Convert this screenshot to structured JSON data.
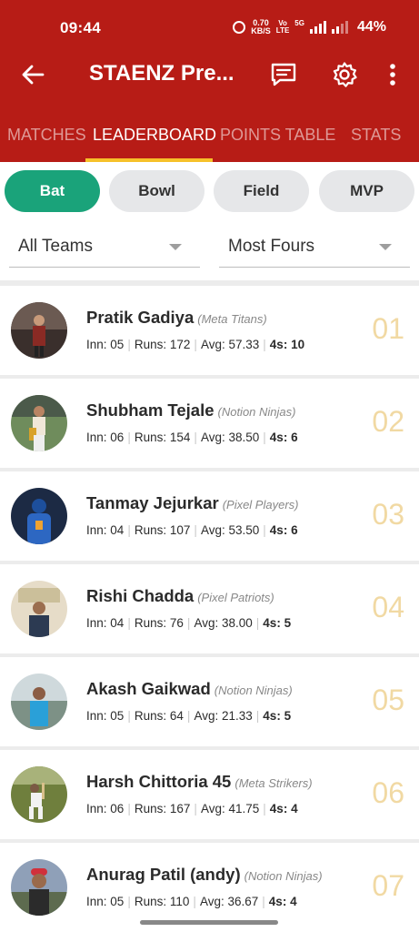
{
  "status_bar": {
    "time": "09:44",
    "speed_top": "0.70",
    "speed_bottom": "KB/S",
    "volte_top": "Vo",
    "volte_bottom": "LTE",
    "network": "5G",
    "battery": "44%"
  },
  "toolbar": {
    "title": "STAENZ Pre..."
  },
  "tabs": [
    {
      "label": "MATCHES",
      "active": false
    },
    {
      "label": "LEADERBOARD",
      "active": true
    },
    {
      "label": "POINTS TABLE",
      "active": false
    },
    {
      "label": "STATS",
      "active": false
    }
  ],
  "chips": [
    {
      "label": "Bat",
      "active": true
    },
    {
      "label": "Bowl",
      "active": false
    },
    {
      "label": "Field",
      "active": false
    },
    {
      "label": "MVP",
      "active": false
    }
  ],
  "filters": {
    "team": "All Teams",
    "metric": "Most Fours"
  },
  "stat_labels": {
    "inn": "Inn:",
    "runs": "Runs:",
    "avg": "Avg:",
    "fours": "4s:"
  },
  "players": [
    {
      "name": "Pratik Gadiya",
      "team": "(Meta Titans)",
      "inn": "05",
      "runs": "172",
      "avg": "57.33",
      "fours": "10",
      "rank": "01"
    },
    {
      "name": "Shubham Tejale",
      "team": "(Notion Ninjas)",
      "inn": "06",
      "runs": "154",
      "avg": "38.50",
      "fours": "6",
      "rank": "02"
    },
    {
      "name": "Tanmay Jejurkar",
      "team": "(Pixel Players)",
      "inn": "04",
      "runs": "107",
      "avg": "53.50",
      "fours": "6",
      "rank": "03"
    },
    {
      "name": "Rishi Chadda",
      "team": "(Pixel Patriots)",
      "inn": "04",
      "runs": "76",
      "avg": "38.00",
      "fours": "5",
      "rank": "04"
    },
    {
      "name": "Akash Gaikwad",
      "team": "(Notion Ninjas)",
      "inn": "05",
      "runs": "64",
      "avg": "21.33",
      "fours": "5",
      "rank": "05"
    },
    {
      "name": "Harsh Chittoria 45",
      "team": "(Meta Strikers)",
      "inn": "06",
      "runs": "167",
      "avg": "41.75",
      "fours": "4",
      "rank": "06"
    },
    {
      "name": "Anurag Patil (andy)",
      "team": "(Notion Ninjas)",
      "inn": "05",
      "runs": "110",
      "avg": "36.67",
      "fours": "4",
      "rank": "07"
    }
  ],
  "colors": {
    "header": "#b71c16",
    "tab_indicator": "#f6c12a",
    "chip_active": "#1aa37a",
    "rank": "#f1d9a3"
  },
  "icons": [
    "back-arrow-icon",
    "chat-icon",
    "settings-gear-icon",
    "more-vert-icon",
    "alarm-icon",
    "signal-icon",
    "dropdown-caret-icon"
  ]
}
